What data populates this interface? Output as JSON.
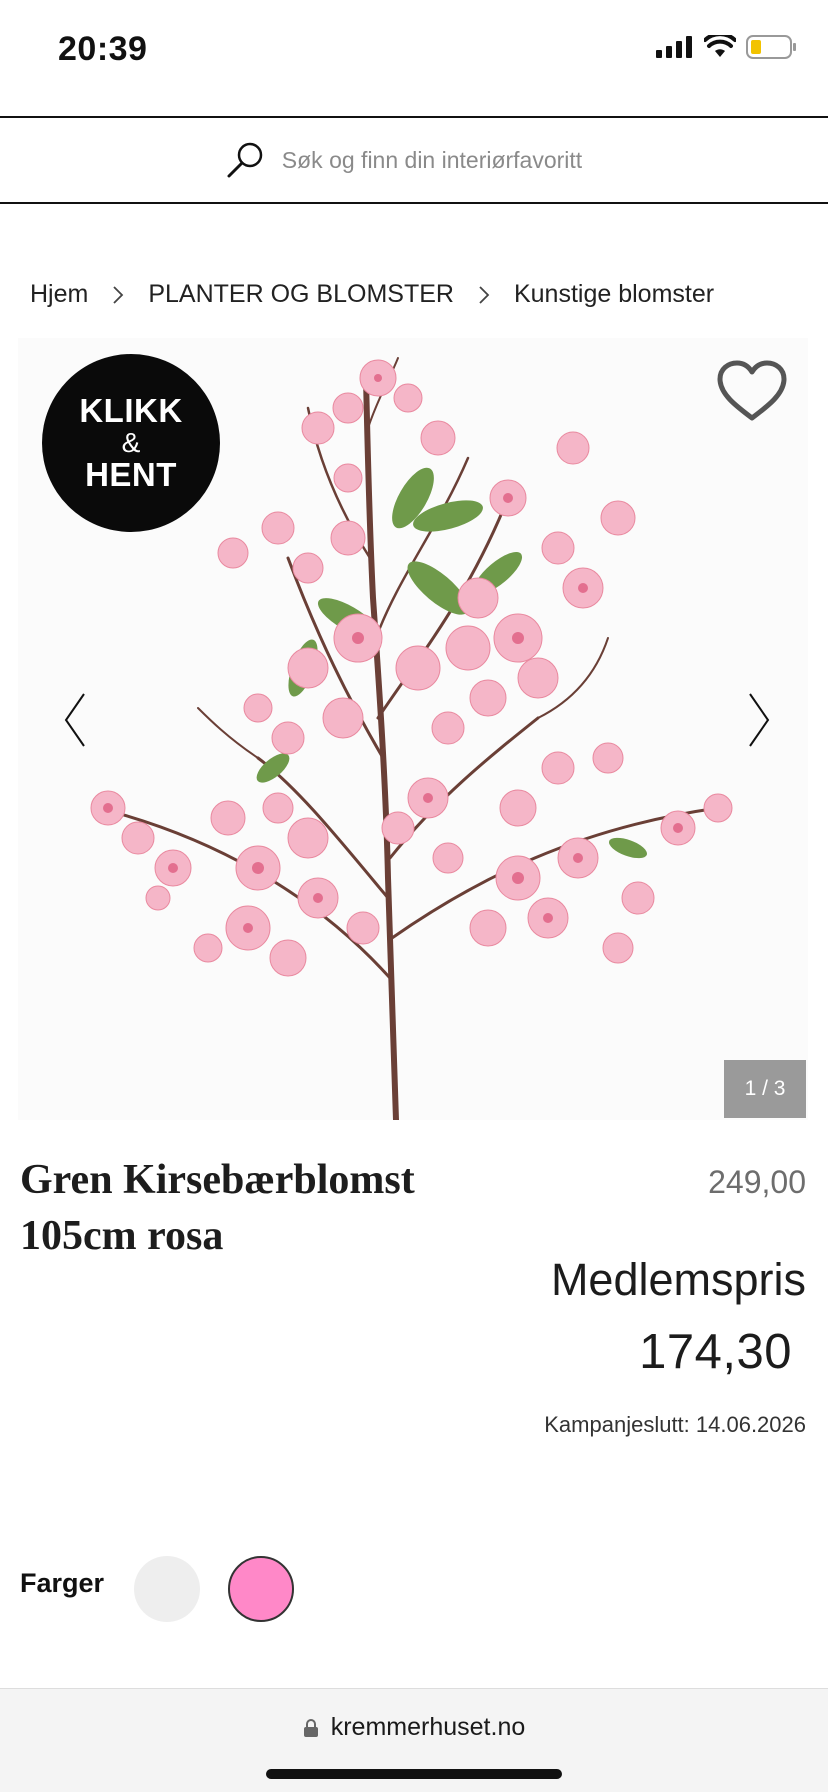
{
  "status": {
    "time": "20:39"
  },
  "search": {
    "placeholder": "Søk og finn din interiørfavoritt"
  },
  "breadcrumb": {
    "items": [
      "Hjem",
      "PLANTER OG BLOMSTER",
      "Kunstige blomster"
    ]
  },
  "gallery": {
    "badge": {
      "line1": "KLIKK",
      "line2": "&",
      "line3": "HENT"
    },
    "counter": "1 / 3"
  },
  "product": {
    "title_line1": "Gren Kirsebærblomst",
    "title_line2": "105cm rosa",
    "price": "249,00",
    "member_label": "Medlemspris",
    "member_price": "174,30",
    "campaign_end": "Kampanjeslutt: 14.06.2026"
  },
  "colors": {
    "label": "Farger",
    "swatches": [
      {
        "name": "white",
        "hex": "#eeeeee"
      },
      {
        "name": "pink",
        "hex": "#ff88c8"
      }
    ]
  },
  "browser": {
    "url": "kremmerhuset.no"
  },
  "theme": {
    "accent_pink": "#ff88c8",
    "blossom_pink": "#f5b6c8",
    "leaf_green": "#6f9a4a",
    "branch_brown": "#6a3f36"
  }
}
